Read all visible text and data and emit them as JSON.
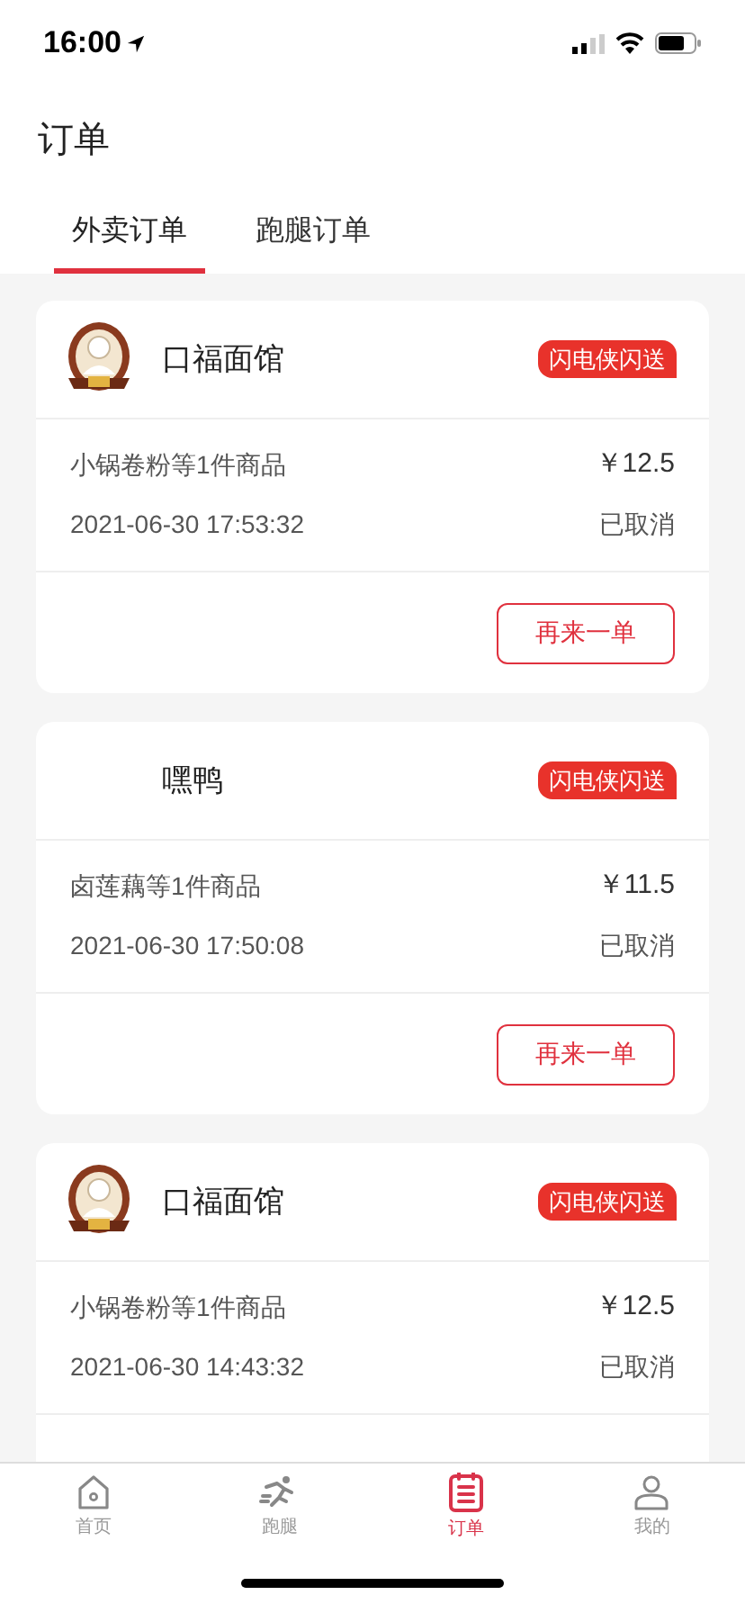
{
  "status_bar": {
    "time": "16:00"
  },
  "title": "订单",
  "tabs": [
    {
      "label": "外卖订单",
      "selected": true
    },
    {
      "label": "跑腿订单",
      "selected": false
    }
  ],
  "orders": [
    {
      "store": "口福面馆",
      "logo": true,
      "badge": "闪电侠闪送",
      "items": "小锅卷粉等1件商品",
      "price": "￥12.5",
      "time": "2021-06-30 17:53:32",
      "status": "已取消",
      "action": "再来一单"
    },
    {
      "store": "嘿鸭",
      "logo": false,
      "badge": "闪电侠闪送",
      "items": "卤莲藕等1件商品",
      "price": "￥11.5",
      "time": "2021-06-30 17:50:08",
      "status": "已取消",
      "action": "再来一单"
    },
    {
      "store": "口福面馆",
      "logo": true,
      "badge": "闪电侠闪送",
      "items": "小锅卷粉等1件商品",
      "price": "￥12.5",
      "time": "2021-06-30 14:43:32",
      "status": "已取消"
    }
  ],
  "tab_bar": [
    {
      "label": "首页",
      "kind": "home",
      "selected": false
    },
    {
      "label": "跑腿",
      "kind": "runner",
      "selected": false
    },
    {
      "label": "订单",
      "kind": "list",
      "selected": true
    },
    {
      "label": "我的",
      "kind": "person",
      "selected": false
    }
  ]
}
